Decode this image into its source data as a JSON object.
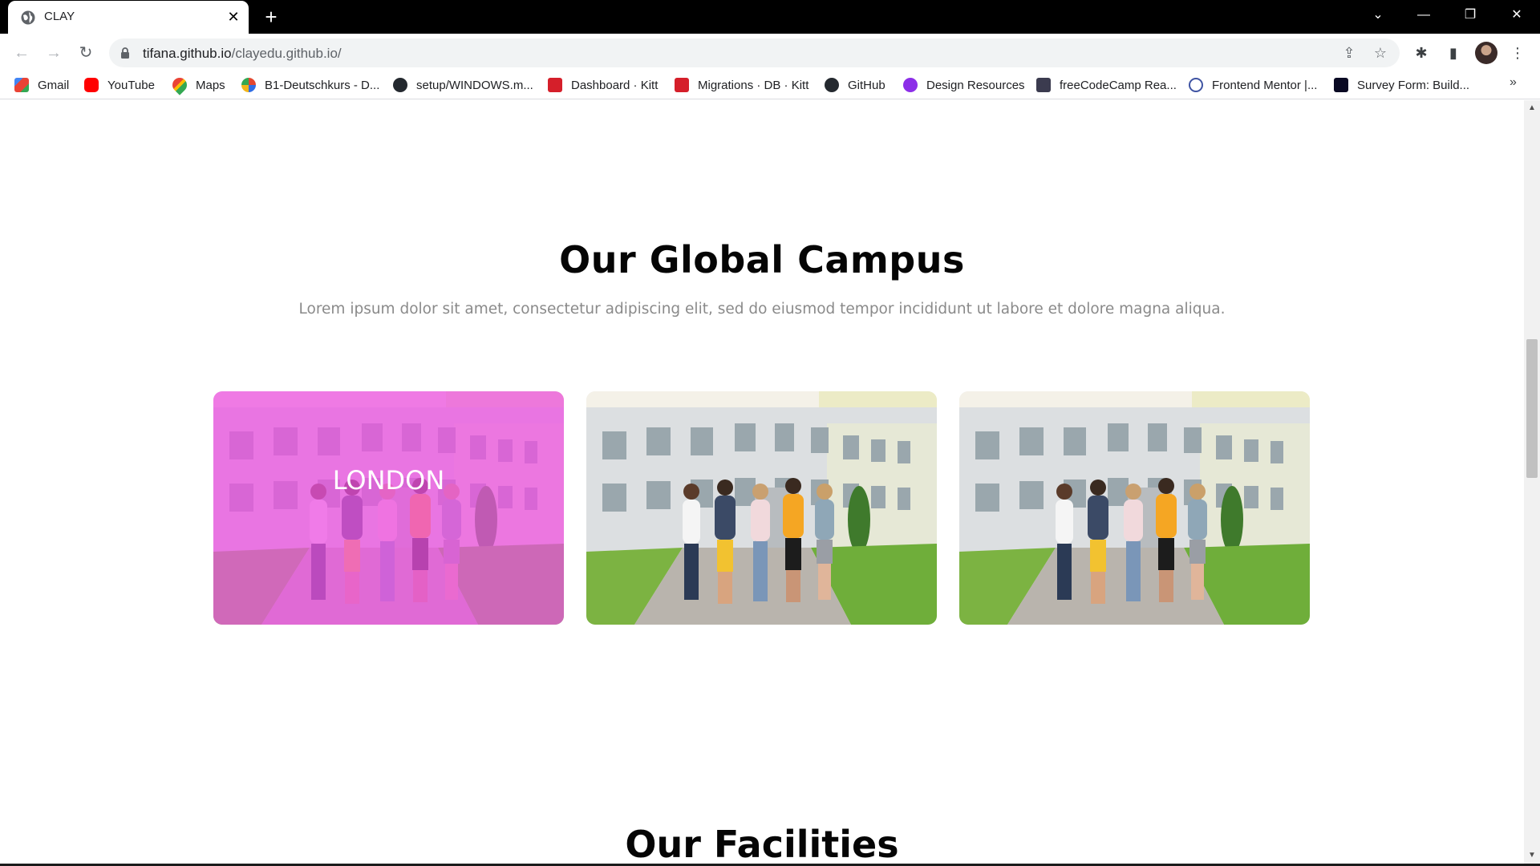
{
  "browser": {
    "tab_title": "CLAY",
    "url_host": "tifana.github.io",
    "url_path": "/clayedu.github.io/",
    "bookmarks": [
      {
        "label": "Gmail",
        "icon": "gmail-icon",
        "color": "#ea4335"
      },
      {
        "label": "YouTube",
        "icon": "youtube-icon",
        "color": "#ff0000"
      },
      {
        "label": "Maps",
        "icon": "maps-icon",
        "color": "#34a853"
      },
      {
        "label": "B1-Deutschkurs - D...",
        "icon": "deutschkurs-icon",
        "color": "#e4472f"
      },
      {
        "label": "setup/WINDOWS.m...",
        "icon": "github-icon",
        "color": "#24292f"
      },
      {
        "label": "Dashboard · Kitt",
        "icon": "kitt-icon",
        "color": "#d51f2a"
      },
      {
        "label": "Migrations · DB · Kitt",
        "icon": "kitt-icon",
        "color": "#d51f2a"
      },
      {
        "label": "GitHub",
        "icon": "github-icon",
        "color": "#24292f"
      },
      {
        "label": "Design Resources",
        "icon": "design-resources-icon",
        "color": "#8c2ee8"
      },
      {
        "label": "freeCodeCamp Rea...",
        "icon": "freecodecamp-icon",
        "color": "#3b3b4f"
      },
      {
        "label": "Frontend Mentor |...",
        "icon": "frontend-mentor-icon",
        "color": "#3f54a3"
      },
      {
        "label": "Survey Form: Build...",
        "icon": "freecodecamp-icon",
        "color": "#0a0a23"
      }
    ],
    "more_bookmarks": "»"
  },
  "page": {
    "global_campus": {
      "title": "Our Global Campus",
      "description": "Lorem ipsum dolor sit amet, consectetur adipiscing elit, sed do eiusmod tempor incididunt ut labore et dolore magna aliqua.",
      "cards": [
        {
          "label": "LONDON",
          "overlay_color": "#ee50e2",
          "hovered": true
        },
        {
          "label": "",
          "hovered": false
        },
        {
          "label": "",
          "hovered": false
        }
      ]
    },
    "facilities": {
      "title": "Our Facilities"
    }
  }
}
